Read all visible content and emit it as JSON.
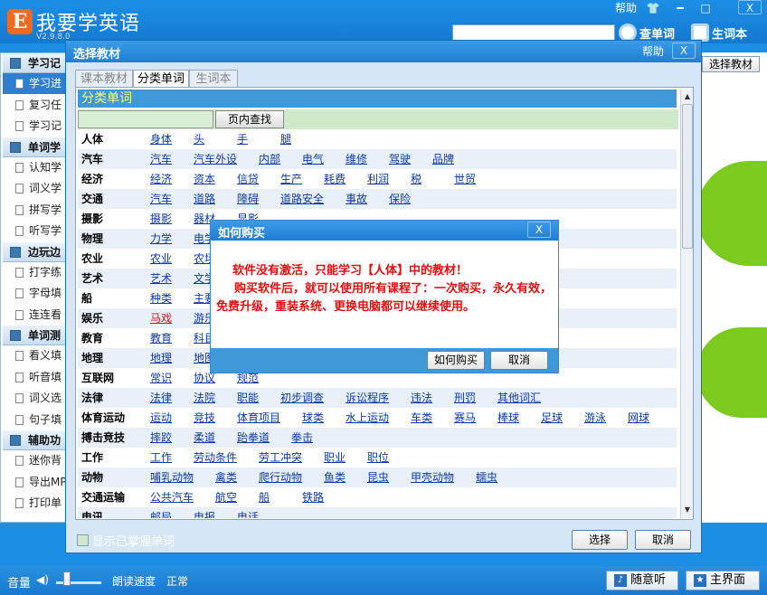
{
  "app": {
    "title": "我要学英语",
    "version": "V2.9.8.0",
    "logo_letter": "E",
    "help": "帮助"
  },
  "window_controls": {
    "shirt": "👕",
    "minimize": "━",
    "maximize": "□",
    "close": "X"
  },
  "top_actions": {
    "lookup": "查单词",
    "vocab": "生词本",
    "search_value": ""
  },
  "left_sidebar": {
    "groups": [
      {
        "label": "学习记",
        "items": [
          "学习进",
          "复习任",
          "学习记"
        ]
      },
      {
        "label": "单词学",
        "items": [
          "认知学",
          "词义学",
          "拼写学",
          "听写学"
        ]
      },
      {
        "label": "边玩边",
        "items": [
          "打字练",
          "字母填",
          "连连看"
        ]
      },
      {
        "label": "单词测",
        "items": [
          "看义填",
          "听音填",
          "词义选",
          "句子填"
        ]
      },
      {
        "label": "辅助功",
        "items": [
          "迷你背",
          "导出MP",
          "打印单"
        ]
      }
    ]
  },
  "right_select_button": "选择教材",
  "dialog": {
    "title": "选择教材",
    "help": "帮助",
    "close": "X",
    "tabs": [
      "课本教材",
      "分类单词",
      "生词本"
    ],
    "list_header": "分类单词",
    "find_placeholder": "",
    "find_button": "页内查找",
    "categories": [
      {
        "name": "人体",
        "words": [
          "身体",
          "头",
          "手",
          "腿"
        ]
      },
      {
        "name": "汽车",
        "words": [
          "汽车",
          "汽车外设",
          "内部",
          "电气",
          "维修",
          "驾驶",
          "品牌"
        ]
      },
      {
        "name": "经济",
        "words": [
          "经济",
          "资本",
          "信贷",
          "生产",
          "耗费",
          "利润",
          "税",
          "世贸"
        ]
      },
      {
        "name": "交通",
        "words": [
          "汽车",
          "道路",
          "障碍",
          "道路安全",
          "事故",
          "保险"
        ]
      },
      {
        "name": "摄影",
        "words": [
          "摄影",
          "器材",
          "显影"
        ]
      },
      {
        "name": "物理",
        "words": [
          "力学",
          "电学"
        ]
      },
      {
        "name": "农业",
        "words": [
          "农业",
          "农场"
        ]
      },
      {
        "name": "艺术",
        "words": [
          "艺术",
          "文学"
        ]
      },
      {
        "name": "船",
        "words": [
          "种类",
          "主要"
        ]
      },
      {
        "name": "娱乐",
        "words": [
          "马戏",
          "游乐"
        ]
      },
      {
        "name": "教育",
        "words": [
          "教育",
          "科目"
        ]
      },
      {
        "name": "地理",
        "words": [
          "地理",
          "地图"
        ]
      },
      {
        "name": "互联网",
        "words": [
          "常识",
          "协议",
          "规范"
        ]
      },
      {
        "name": "法律",
        "words": [
          "法律",
          "法院",
          "职能",
          "初步调查",
          "诉讼程序",
          "违法",
          "刑罚",
          "其他词汇"
        ]
      },
      {
        "name": "体育运动",
        "words": [
          "运动",
          "竞技",
          "体育项目",
          "球类",
          "水上运动",
          "车类",
          "赛马",
          "棒球",
          "足球",
          "游泳",
          "网球"
        ]
      },
      {
        "name": "搏击竞技",
        "words": [
          "摔跤",
          "柔道",
          "跆拳道",
          "拳击"
        ]
      },
      {
        "name": "工作",
        "words": [
          "工作",
          "劳动条件",
          "劳工冲突",
          "职业",
          "职位"
        ]
      },
      {
        "name": "动物",
        "words": [
          "哺乳动物",
          "禽类",
          "爬行动物",
          "鱼类",
          "昆虫",
          "甲壳动物",
          "蠕虫"
        ]
      },
      {
        "name": "交通运输",
        "words": [
          "公共汽车",
          "航空",
          "船",
          "铁路"
        ]
      },
      {
        "name": "电讯",
        "words": [
          "邮局",
          "电报",
          "电话"
        ]
      }
    ],
    "show_mastered": "显示已掌握单词",
    "select_button": "选择",
    "cancel_button": "取消"
  },
  "popup": {
    "title": "如何购买",
    "close": "X",
    "message1": "软件没有激活，只能学习【人体】中的教材！",
    "message2": "购买软件后，就可以使用所有课程了：一次购买，永久有效，免费升级，重装系统、更换电脑都可以继续使用。",
    "buy_button": "如何购买",
    "cancel_button": "取消"
  },
  "bottom": {
    "volume": "音量",
    "speaker_icon": "◀)",
    "read_speed": "朗读速度",
    "speed_value": "正常",
    "random_listen": "随意听",
    "home": "主界面",
    "volume_level": 0.25
  },
  "colors": {
    "accent": "#1f7fd4",
    "link": "#0b3aa8",
    "warning": "#e01010",
    "green": "#7acb1e"
  }
}
